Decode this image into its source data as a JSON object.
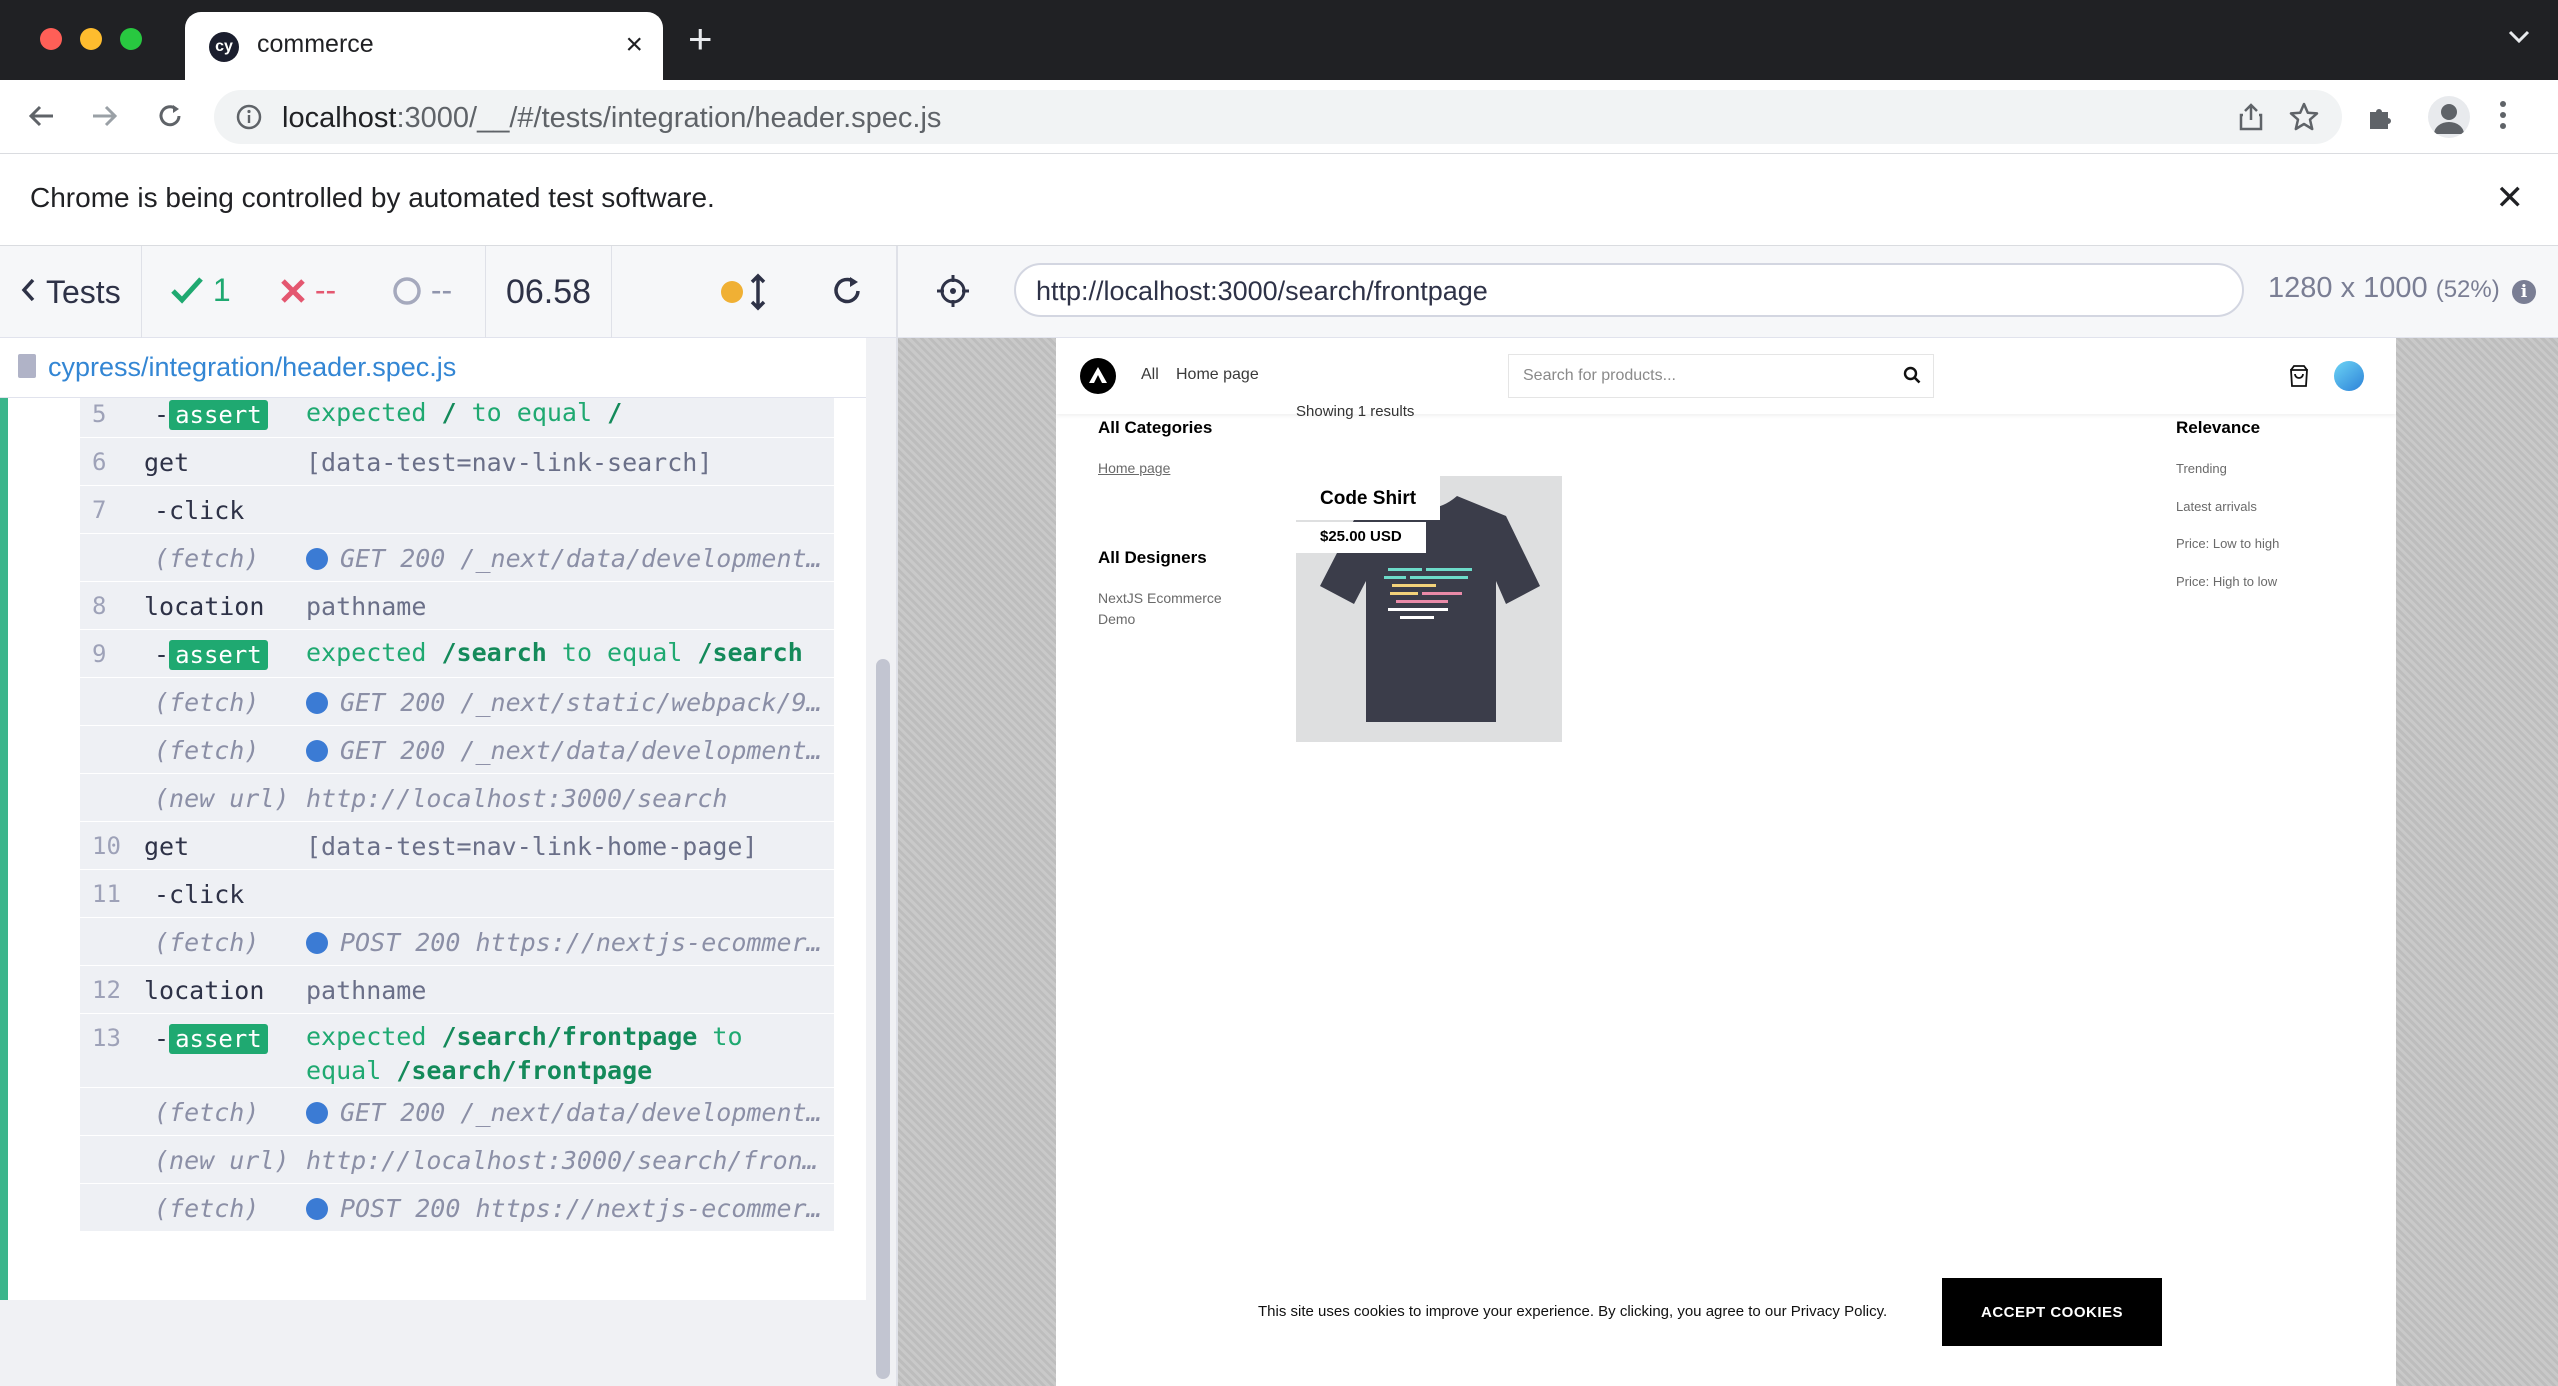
{
  "browser": {
    "tab_title": "commerce",
    "tab_favicon": "cy",
    "address_host": "localhost",
    "address_rest": ":3000/__/#/tests/integration/header.spec.js",
    "infobar_text": "Chrome is being controlled by automated test software."
  },
  "reporter": {
    "tests_label": "Tests",
    "passed_count": "1",
    "failed_count": "--",
    "pending_count": "--",
    "duration": "06.58",
    "spec_path": "cypress/integration/header.spec.js",
    "commands": [
      {
        "num": "5",
        "name": "-assert",
        "type": "assert",
        "msg_parts": [
          "expected",
          "/",
          "to equal",
          "/"
        ]
      },
      {
        "num": "6",
        "name": "get",
        "type": "cmd",
        "msg": "[data-test=nav-link-search]"
      },
      {
        "num": "7",
        "name": "-click",
        "type": "child",
        "msg": ""
      },
      {
        "num": "",
        "name": "(fetch)",
        "type": "event",
        "msg": "GET 200 /_next/data/development…"
      },
      {
        "num": "8",
        "name": "location",
        "type": "cmd",
        "msg": "pathname"
      },
      {
        "num": "9",
        "name": "-assert",
        "type": "assert",
        "msg_parts": [
          "expected",
          "/search",
          "to equal",
          "/search"
        ]
      },
      {
        "num": "",
        "name": "(fetch)",
        "type": "event",
        "msg": "GET 200 /_next/static/webpack/9…"
      },
      {
        "num": "",
        "name": "(fetch)",
        "type": "event",
        "msg": "GET 200 /_next/data/development…"
      },
      {
        "num": "",
        "name": "(new url)",
        "type": "url",
        "msg": "http://localhost:3000/search"
      },
      {
        "num": "10",
        "name": "get",
        "type": "cmd",
        "msg": "[data-test=nav-link-home-page]"
      },
      {
        "num": "11",
        "name": "-click",
        "type": "child",
        "msg": ""
      },
      {
        "num": "",
        "name": "(fetch)",
        "type": "event",
        "msg": "POST 200 https://nextjs-ecommer…"
      },
      {
        "num": "12",
        "name": "location",
        "type": "cmd",
        "msg": "pathname"
      },
      {
        "num": "13",
        "name": "-assert",
        "type": "assert2",
        "msg_parts": [
          "expected",
          "/search/frontpage",
          "to",
          "equal",
          "/search/frontpage"
        ]
      },
      {
        "num": "",
        "name": "(fetch)",
        "type": "event",
        "msg": "GET 200 /_next/data/development…"
      },
      {
        "num": "",
        "name": "(new url)",
        "type": "url",
        "msg": "http://localhost:3000/search/front…"
      },
      {
        "num": "",
        "name": "(fetch)",
        "type": "event",
        "msg": "POST 200 https://nextjs-ecommer…"
      }
    ]
  },
  "aut": {
    "url": "http://localhost:3000/search/frontpage",
    "viewport": "1280 x 1000",
    "scale": "(52%)"
  },
  "site": {
    "nav_all": "All",
    "nav_home": "Home page",
    "search_placeholder": "Search for products...",
    "showing": "Showing 1 results",
    "categories_title": "All Categories",
    "category_home": "Home page",
    "designers_title": "All Designers",
    "designer_1": "NextJS Ecommerce",
    "designer_2": "Demo",
    "product_title": "Code Shirt",
    "product_price": "$25.00 USD",
    "sort_title": "Relevance",
    "sort_options": [
      "Trending",
      "Latest arrivals",
      "Price: Low to high",
      "Price: High to low"
    ],
    "cookie_text": "This site uses cookies to improve your experience. By clicking, you agree to our Privacy Policy.",
    "cookie_button": "ACCEPT COOKIES"
  }
}
